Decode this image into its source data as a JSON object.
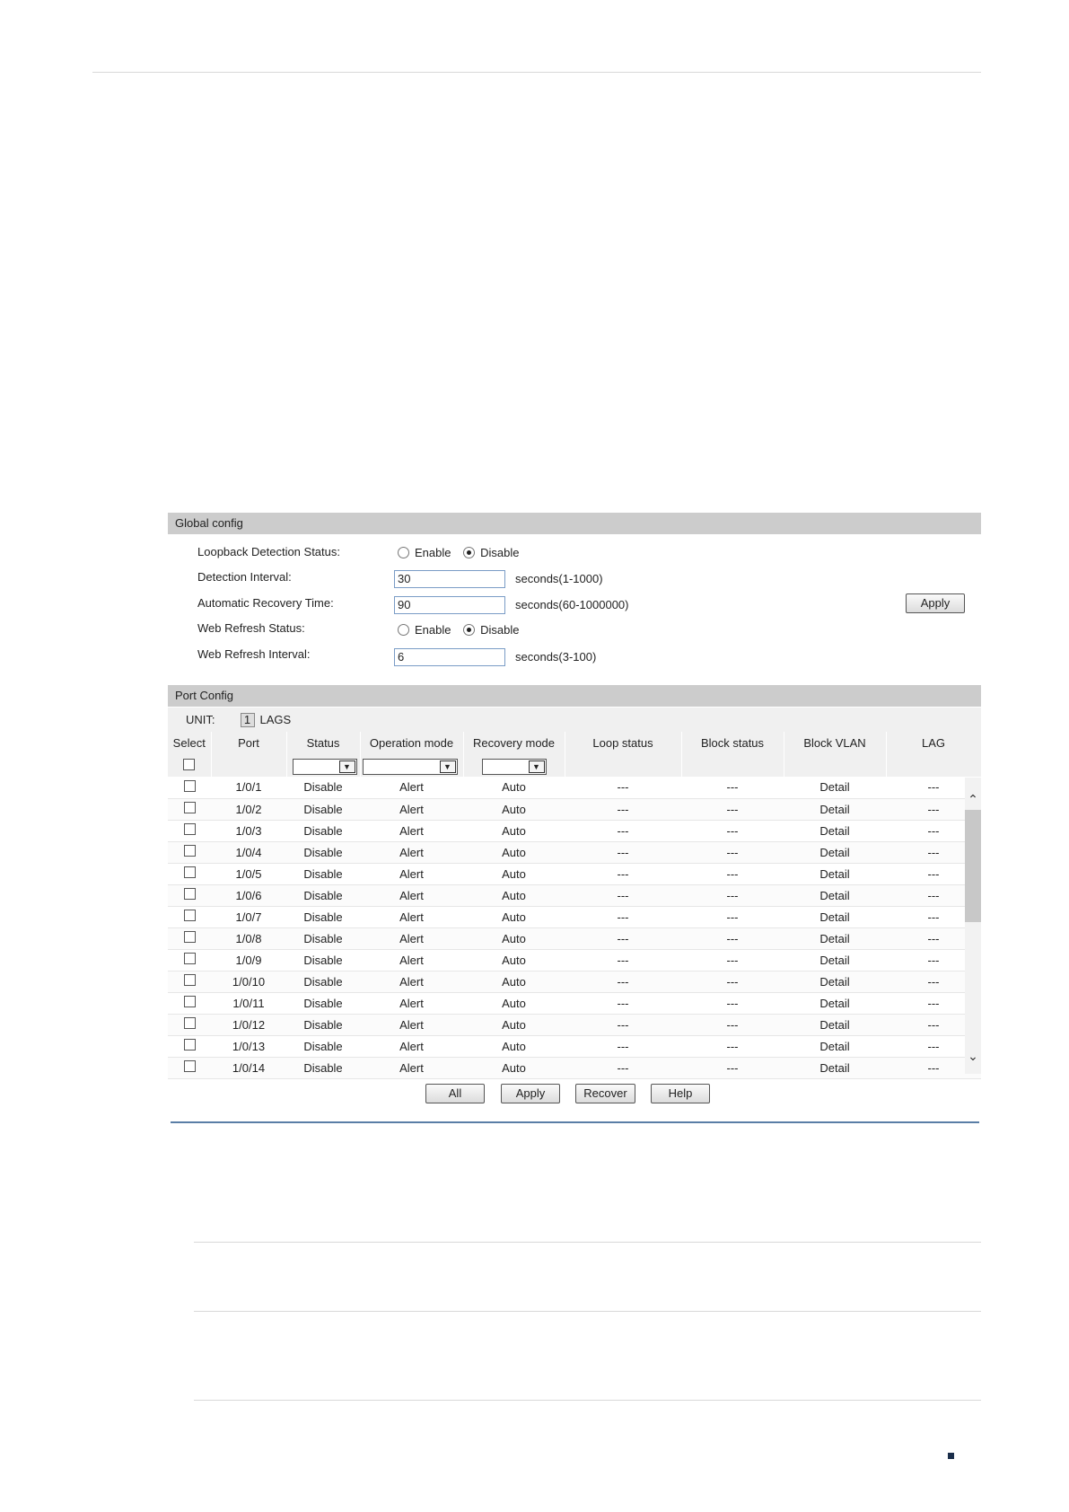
{
  "global_config": {
    "title": "Global config",
    "loopback_detection_status": {
      "label": "Loopback Detection Status:",
      "enable_label": "Enable",
      "disable_label": "Disable",
      "selected": "Disable"
    },
    "detection_interval": {
      "label": "Detection Interval:",
      "value": "30",
      "hint": "seconds(1-1000)"
    },
    "automatic_recovery_time": {
      "label": "Automatic Recovery Time:",
      "value": "90",
      "hint": "seconds(60-1000000)"
    },
    "web_refresh_status": {
      "label": "Web Refresh Status:",
      "enable_label": "Enable",
      "disable_label": "Disable",
      "selected": "Disable"
    },
    "web_refresh_interval": {
      "label": "Web Refresh Interval:",
      "value": "6",
      "hint": "seconds(3-100)"
    },
    "apply_label": "Apply"
  },
  "port_config": {
    "title": "Port Config",
    "unit_label": "UNIT:",
    "unit_value": "1",
    "lags_label": "LAGS",
    "columns": [
      "Select",
      "Port",
      "Status",
      "Operation mode",
      "Recovery mode",
      "Loop status",
      "Block status",
      "Block VLAN",
      "LAG"
    ],
    "rows": [
      {
        "port": "1/0/1",
        "status": "Disable",
        "operation_mode": "Alert",
        "recovery_mode": "Auto",
        "loop_status": "---",
        "block_status": "---",
        "block_vlan": "Detail",
        "lag": "---"
      },
      {
        "port": "1/0/2",
        "status": "Disable",
        "operation_mode": "Alert",
        "recovery_mode": "Auto",
        "loop_status": "---",
        "block_status": "---",
        "block_vlan": "Detail",
        "lag": "---"
      },
      {
        "port": "1/0/3",
        "status": "Disable",
        "operation_mode": "Alert",
        "recovery_mode": "Auto",
        "loop_status": "---",
        "block_status": "---",
        "block_vlan": "Detail",
        "lag": "---"
      },
      {
        "port": "1/0/4",
        "status": "Disable",
        "operation_mode": "Alert",
        "recovery_mode": "Auto",
        "loop_status": "---",
        "block_status": "---",
        "block_vlan": "Detail",
        "lag": "---"
      },
      {
        "port": "1/0/5",
        "status": "Disable",
        "operation_mode": "Alert",
        "recovery_mode": "Auto",
        "loop_status": "---",
        "block_status": "---",
        "block_vlan": "Detail",
        "lag": "---"
      },
      {
        "port": "1/0/6",
        "status": "Disable",
        "operation_mode": "Alert",
        "recovery_mode": "Auto",
        "loop_status": "---",
        "block_status": "---",
        "block_vlan": "Detail",
        "lag": "---"
      },
      {
        "port": "1/0/7",
        "status": "Disable",
        "operation_mode": "Alert",
        "recovery_mode": "Auto",
        "loop_status": "---",
        "block_status": "---",
        "block_vlan": "Detail",
        "lag": "---"
      },
      {
        "port": "1/0/8",
        "status": "Disable",
        "operation_mode": "Alert",
        "recovery_mode": "Auto",
        "loop_status": "---",
        "block_status": "---",
        "block_vlan": "Detail",
        "lag": "---"
      },
      {
        "port": "1/0/9",
        "status": "Disable",
        "operation_mode": "Alert",
        "recovery_mode": "Auto",
        "loop_status": "---",
        "block_status": "---",
        "block_vlan": "Detail",
        "lag": "---"
      },
      {
        "port": "1/0/10",
        "status": "Disable",
        "operation_mode": "Alert",
        "recovery_mode": "Auto",
        "loop_status": "---",
        "block_status": "---",
        "block_vlan": "Detail",
        "lag": "---"
      },
      {
        "port": "1/0/11",
        "status": "Disable",
        "operation_mode": "Alert",
        "recovery_mode": "Auto",
        "loop_status": "---",
        "block_status": "---",
        "block_vlan": "Detail",
        "lag": "---"
      },
      {
        "port": "1/0/12",
        "status": "Disable",
        "operation_mode": "Alert",
        "recovery_mode": "Auto",
        "loop_status": "---",
        "block_status": "---",
        "block_vlan": "Detail",
        "lag": "---"
      },
      {
        "port": "1/0/13",
        "status": "Disable",
        "operation_mode": "Alert",
        "recovery_mode": "Auto",
        "loop_status": "---",
        "block_status": "---",
        "block_vlan": "Detail",
        "lag": "---"
      },
      {
        "port": "1/0/14",
        "status": "Disable",
        "operation_mode": "Alert",
        "recovery_mode": "Auto",
        "loop_status": "---",
        "block_status": "---",
        "block_vlan": "Detail",
        "lag": "---"
      }
    ],
    "buttons": {
      "all": "All",
      "apply": "Apply",
      "recover": "Recover",
      "help": "Help"
    }
  },
  "icons": {
    "scroll_up": "chevron-up-icon",
    "scroll_down": "chevron-down-icon",
    "dropdown": "dropdown-arrow-icon"
  },
  "colors": {
    "section_header_bg": "#cccccc",
    "field_border": "#7a9cc6",
    "rule_blue": "#5a7ea6",
    "page_mark": "#1a2e4a"
  }
}
